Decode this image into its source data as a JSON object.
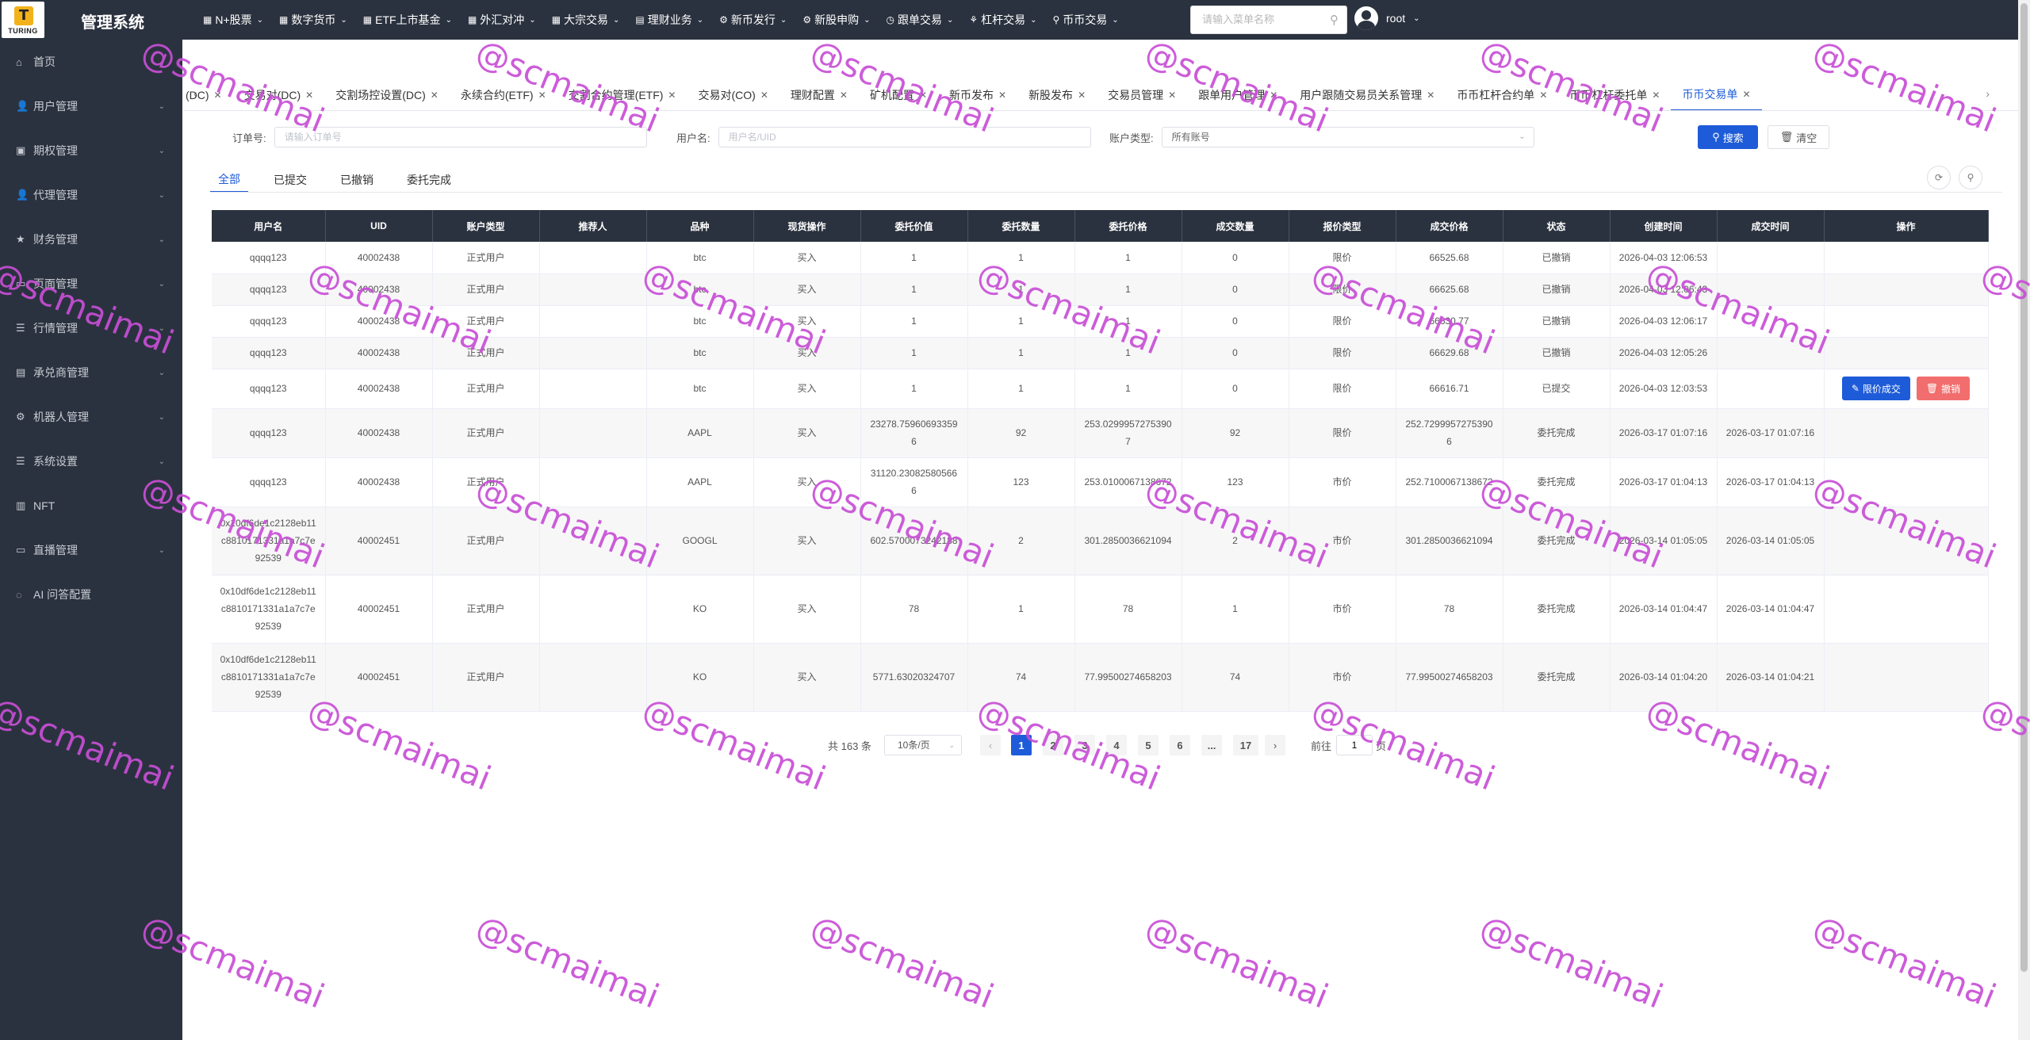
{
  "header": {
    "logo_text": "TURING",
    "logo_mark": "T",
    "title": "管理系统",
    "menu_search_placeholder": "请输入菜单名称",
    "username": "root",
    "menu": [
      {
        "icon": "▦",
        "label": "N+股票"
      },
      {
        "icon": "▦",
        "label": "数字货币"
      },
      {
        "icon": "▦",
        "label": "ETF上市基金"
      },
      {
        "icon": "▦",
        "label": "外汇对冲"
      },
      {
        "icon": "▦",
        "label": "大宗交易"
      },
      {
        "icon": "▤",
        "label": "理财业务"
      },
      {
        "icon": "⚙",
        "label": "新币发行"
      },
      {
        "icon": "⚙",
        "label": "新股申购"
      },
      {
        "icon": "◷",
        "label": "跟单交易"
      },
      {
        "icon": "⚘",
        "label": "杠杆交易"
      },
      {
        "icon": "⚲",
        "label": "币币交易"
      }
    ]
  },
  "sidebar": {
    "items": [
      {
        "icon": "⌂",
        "label": "首页",
        "has_children": false
      },
      {
        "icon": "👤",
        "label": "用户管理",
        "has_children": true
      },
      {
        "icon": "▣",
        "label": "期权管理",
        "has_children": true
      },
      {
        "icon": "👤",
        "label": "代理管理",
        "has_children": true
      },
      {
        "icon": "★",
        "label": "财务管理",
        "has_children": true
      },
      {
        "icon": "▭",
        "label": "页面管理",
        "has_children": true
      },
      {
        "icon": "☰",
        "label": "行情管理",
        "has_children": true
      },
      {
        "icon": "▤",
        "label": "承兑商管理",
        "has_children": true
      },
      {
        "icon": "⚙",
        "label": "机器人管理",
        "has_children": true
      },
      {
        "icon": "☰",
        "label": "系统设置",
        "has_children": true
      },
      {
        "icon": "▥",
        "label": "NFT",
        "has_children": true
      },
      {
        "icon": "▭",
        "label": "直播管理",
        "has_children": true
      },
      {
        "icon": "◌",
        "label": "AI 问答配置",
        "has_children": false
      }
    ]
  },
  "tabs": {
    "items": [
      "(DC)",
      "交易对(DC)",
      "交割场控设置(DC)",
      "永续合约(ETF)",
      "交割合约管理(ETF)",
      "交易对(CO)",
      "理财配置",
      "矿机配置",
      "新币发布",
      "新股发布",
      "交易员管理",
      "跟单用户管理",
      "用户跟随交易员关系管理",
      "币币杠杆合约单",
      "币币杠杆委托单",
      "币币交易单"
    ],
    "active_index": 15
  },
  "filters": {
    "order_label": "订单号:",
    "order_placeholder": "请输入订单号",
    "user_label": "用户名:",
    "user_placeholder": "用户名/UID",
    "account_label": "账户类型:",
    "account_value": "所有账号",
    "search_label": "搜索",
    "clear_label": "清空"
  },
  "subtabs": {
    "items": [
      "全部",
      "已提交",
      "已撤销",
      "委托完成"
    ],
    "active_index": 0
  },
  "table": {
    "columns": [
      "用户名",
      "UID",
      "账户类型",
      "推荐人",
      "品种",
      "现货操作",
      "委托价值",
      "委托数量",
      "委托价格",
      "成交数量",
      "报价类型",
      "成交价格",
      "状态",
      "创建时间",
      "成交时间",
      "操作"
    ],
    "rows": [
      {
        "username": "qqqq123",
        "uid": "40002438",
        "account": "正式用户",
        "referrer": "",
        "symbol": "btc",
        "op": "买入",
        "value": "1",
        "qty": "1",
        "price": "1",
        "filled": "0",
        "quote": "限价",
        "deal_price": "66525.68",
        "status": "已撤销",
        "created": "2026-04-03 12:06:53",
        "dealt": "",
        "actions": false
      },
      {
        "username": "qqqq123",
        "uid": "40002438",
        "account": "正式用户",
        "referrer": "",
        "symbol": "btc",
        "op": "买入",
        "value": "1",
        "qty": "1",
        "price": "1",
        "filled": "0",
        "quote": "限价",
        "deal_price": "66625.68",
        "status": "已撤销",
        "created": "2026-04-03 12:06:43",
        "dealt": "",
        "actions": false
      },
      {
        "username": "qqqq123",
        "uid": "40002438",
        "account": "正式用户",
        "referrer": "",
        "symbol": "btc",
        "op": "买入",
        "value": "1",
        "qty": "1",
        "price": "1",
        "filled": "0",
        "quote": "限价",
        "deal_price": "66630.77",
        "status": "已撤销",
        "created": "2026-04-03 12:06:17",
        "dealt": "",
        "actions": false
      },
      {
        "username": "qqqq123",
        "uid": "40002438",
        "account": "正式用户",
        "referrer": "",
        "symbol": "btc",
        "op": "买入",
        "value": "1",
        "qty": "1",
        "price": "1",
        "filled": "0",
        "quote": "限价",
        "deal_price": "66629.68",
        "status": "已撤销",
        "created": "2026-04-03 12:05:26",
        "dealt": "",
        "actions": false
      },
      {
        "username": "qqqq123",
        "uid": "40002438",
        "account": "正式用户",
        "referrer": "",
        "symbol": "btc",
        "op": "买入",
        "value": "1",
        "qty": "1",
        "price": "1",
        "filled": "0",
        "quote": "限价",
        "deal_price": "66616.71",
        "status": "已提交",
        "created": "2026-04-03 12:03:53",
        "dealt": "",
        "actions": true
      },
      {
        "username": "qqqq123",
        "uid": "40002438",
        "account": "正式用户",
        "referrer": "",
        "symbol": "AAPL",
        "op": "买入",
        "value": "23278.75960693359\n6",
        "qty": "92",
        "price": "253.0299957275390\n7",
        "filled": "92",
        "quote": "限价",
        "deal_price": "252.7299957275390\n6",
        "status": "委托完成",
        "created": "2026-03-17 01:07:16",
        "dealt": "2026-03-17 01:07:16",
        "actions": false
      },
      {
        "username": "qqqq123",
        "uid": "40002438",
        "account": "正式用户",
        "referrer": "",
        "symbol": "AAPL",
        "op": "买入",
        "value": "31120.23082580566\n6",
        "qty": "123",
        "price": "253.0100067138672",
        "filled": "123",
        "quote": "市价",
        "deal_price": "252.7100067138672",
        "status": "委托完成",
        "created": "2026-03-17 01:04:13",
        "dealt": "2026-03-17 01:04:13",
        "actions": false
      },
      {
        "username": "0x10df6de1c2128eb11c8810171331a1a7c7e92539",
        "uid": "40002451",
        "account": "正式用户",
        "referrer": "",
        "symbol": "GOOGL",
        "op": "买入",
        "value": "602.5700073242188",
        "qty": "2",
        "price": "301.2850036621094",
        "filled": "2",
        "quote": "市价",
        "deal_price": "301.2850036621094",
        "status": "委托完成",
        "created": "2026-03-14 01:05:05",
        "dealt": "2026-03-14 01:05:05",
        "actions": false
      },
      {
        "username": "0x10df6de1c2128eb11c8810171331a1a7c7e92539",
        "uid": "40002451",
        "account": "正式用户",
        "referrer": "",
        "symbol": "KO",
        "op": "买入",
        "value": "78",
        "qty": "1",
        "price": "78",
        "filled": "1",
        "quote": "市价",
        "deal_price": "78",
        "status": "委托完成",
        "created": "2026-03-14 01:04:47",
        "dealt": "2026-03-14 01:04:47",
        "actions": false
      },
      {
        "username": "0x10df6de1c2128eb11c8810171331a1a7c7e92539",
        "uid": "40002451",
        "account": "正式用户",
        "referrer": "",
        "symbol": "KO",
        "op": "买入",
        "value": "5771.63020324707",
        "qty": "74",
        "price": "77.99500274658203",
        "filled": "74",
        "quote": "市价",
        "deal_price": "77.99500274658203",
        "status": "委托完成",
        "created": "2026-03-14 01:04:20",
        "dealt": "2026-03-14 01:04:21",
        "actions": false
      }
    ],
    "action_limit_label": "限价成交",
    "action_cancel_label": "撤销"
  },
  "pagination": {
    "total": "共 163 条",
    "page_size": "10条/页",
    "pages": [
      "1",
      "2",
      "3",
      "4",
      "5",
      "6",
      "...",
      "17"
    ],
    "current": "1",
    "goto_prefix": "前往",
    "goto_value": "1",
    "goto_suffix": "页"
  },
  "watermark": "@scmaimai",
  "colors": {
    "brand": "#1e5bd8",
    "dark": "#2b323f",
    "buy": "#3bb33b",
    "danger": "#f26d6d",
    "watermark": "#c84fd6"
  }
}
